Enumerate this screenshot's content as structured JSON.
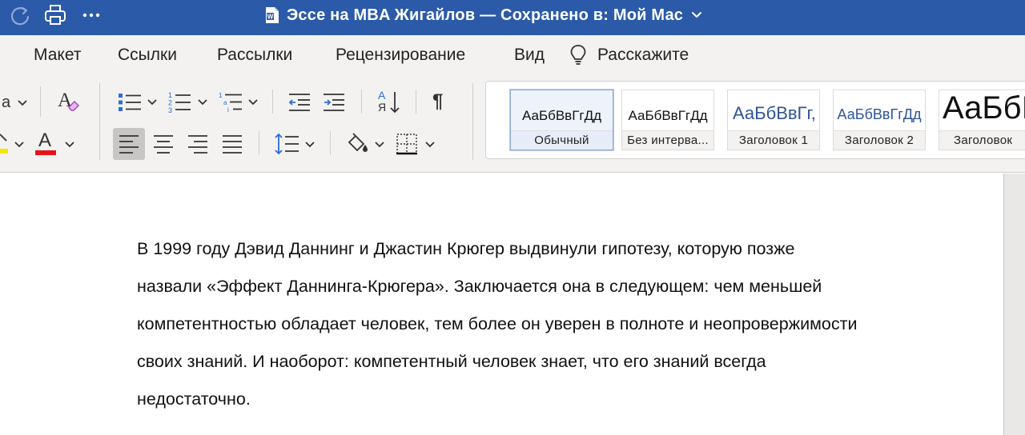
{
  "titlebar": {
    "title": "Эссе на MBA Жигайлов — Сохранено в: Мой Мас",
    "bg_color": "#2b5aa8",
    "icons": [
      "redo-icon",
      "print-icon",
      "more-icon",
      "word-doc-icon",
      "chevron-down-icon"
    ]
  },
  "menu": {
    "items": [
      "Макет",
      "Ссылки",
      "Рассылки",
      "Рецензирование",
      "Вид",
      "Расскажите"
    ]
  },
  "ribbon": {
    "font_fragment": "a",
    "clear_format_glyph": "A",
    "font_color_glyph": "A",
    "font_color": "#e8121b",
    "highlight_color": "#f5e800",
    "sort_glyph_top": "А",
    "sort_glyph_bottom": "Я",
    "pilcrow": "¶",
    "icons": [
      "bullets-icon",
      "numbering-icon",
      "multilevel-icon",
      "decrease-indent-icon",
      "increase-indent-icon",
      "sort-icon",
      "show-marks-icon",
      "align-left-icon",
      "align-center-icon",
      "align-right-icon",
      "justify-icon",
      "line-spacing-icon",
      "shading-icon",
      "borders-icon"
    ]
  },
  "styles": [
    {
      "sample": "АаБбВвГгДд",
      "name": "Обычный",
      "selected": true
    },
    {
      "sample": "АаБбВвГгДд",
      "name": "Без интерва..."
    },
    {
      "sample": "АаБбВвГг,",
      "name": "Заголовок 1",
      "color": "#2f5597"
    },
    {
      "sample": "АаБбВвГгДд",
      "name": "Заголовок 2",
      "color": "#2f5597"
    },
    {
      "sample": "АаБбI",
      "name": "Заголовок"
    }
  ],
  "document": {
    "lines": [
      "В 1999 году Дэвид Даннинг и Джастин Крюгер выдвинули гипотезу, которую позже",
      "назвали «Эффект Даннинга-Крюгера». Заключается она в следующем: чем меньшей",
      "компетентностью обладает человек, тем более он уверен в полноте и неопровержимости",
      "своих знаний. И наоборот: компетентный человек знает, что его знаний всегда",
      "недостаточно."
    ]
  }
}
